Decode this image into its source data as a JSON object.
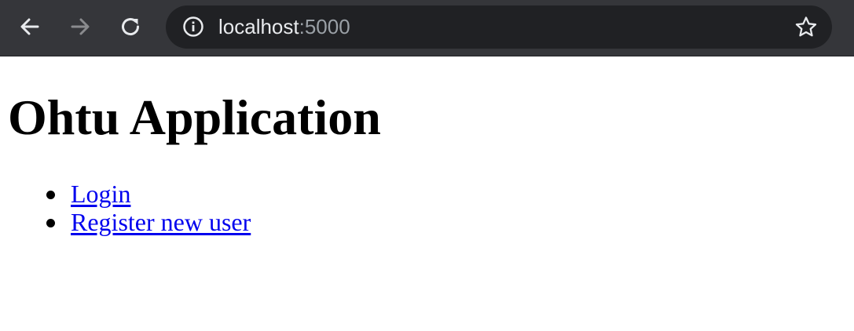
{
  "browser": {
    "url_host": "localhost",
    "url_port": ":5000",
    "icons": {
      "back": "arrow-left-icon",
      "forward": "arrow-right-icon",
      "reload": "reload-icon",
      "site_info": "info-icon",
      "bookmark": "star-icon"
    },
    "colors": {
      "toolbar": "#35363a",
      "omnibox": "#202124",
      "icon_active": "#e8eaed",
      "icon_disabled": "#8a8b8e"
    }
  },
  "page": {
    "title": "Ohtu Application",
    "links": [
      {
        "label": "Login"
      },
      {
        "label": "Register new user"
      }
    ],
    "colors": {
      "link": "#0000ee",
      "text": "#000000"
    }
  }
}
